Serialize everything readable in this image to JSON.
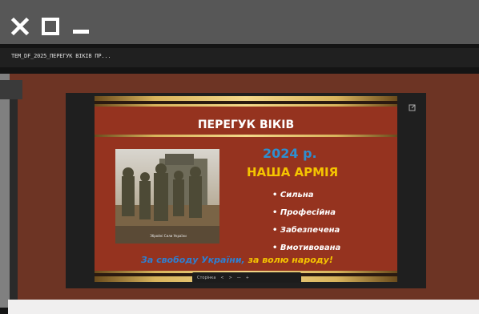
{
  "window": {
    "controls": [
      {
        "name": "close-icon"
      },
      {
        "name": "maximize-icon"
      },
      {
        "name": "minimize-icon"
      }
    ]
  },
  "file": {
    "name": "TEM_DF_2025_ПЕРЕГУК ВІКІВ ПР..."
  },
  "slide": {
    "title": "ПЕРЕГУК ВІКІВ",
    "year": "2024 р.",
    "heading": "НАША АРМІЯ",
    "bullets": [
      "• Сильна",
      "• Професійна",
      "• Забезпечена",
      "• Вмотивована"
    ],
    "slogan_blue": "За свободу України,",
    "slogan_yellow": " за волю народу!",
    "photo_caption": "Збройні Сили України"
  },
  "viewer": {
    "nav_label": "Сторінка",
    "nav_items": [
      "<",
      ">",
      "—",
      "+"
    ]
  },
  "colors": {
    "slide_bg": "#95331f",
    "year": "#2e8fd0",
    "heading": "#f5c400"
  }
}
